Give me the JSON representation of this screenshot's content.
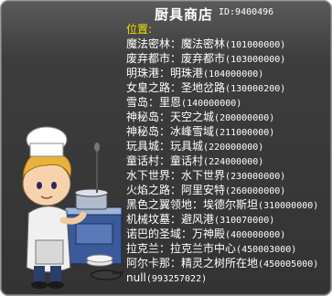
{
  "shop": {
    "title": "厨具商店",
    "npc_id": "ID:9400496",
    "header": "位置:",
    "locations": [
      {
        "region": "魔法密林",
        "sep": "：",
        "place": "魔法密林",
        "code": "(101000000)"
      },
      {
        "region": "废弃都市",
        "sep": "：",
        "place": "废弃都市",
        "code": "(103000000)"
      },
      {
        "region": "明珠港",
        "sep": "：",
        "place": "明珠港",
        "code": "(104000000)"
      },
      {
        "region": "女皇之路",
        "sep": "：",
        "place": "圣地岔路",
        "code": "(130000200)"
      },
      {
        "region": "雪岛",
        "sep": "：",
        "place": "里恩",
        "code": "(140000000)"
      },
      {
        "region": "神秘岛",
        "sep": "：",
        "place": "天空之城",
        "code": "(200000000)"
      },
      {
        "region": "神秘岛",
        "sep": "：",
        "place": "冰峰雪域",
        "code": "(211000000)"
      },
      {
        "region": "玩具城",
        "sep": "：",
        "place": "玩具城",
        "code": "(220000000)"
      },
      {
        "region": "童话村",
        "sep": "：",
        "place": "童话村",
        "code": "(224000000)"
      },
      {
        "region": "水下世界",
        "sep": "：",
        "place": "水下世界",
        "code": "(230000000)"
      },
      {
        "region": "火焰之路",
        "sep": "：",
        "place": "阿里安特",
        "code": "(260000000)"
      },
      {
        "region": "黑色之翼领地",
        "sep": "：",
        "place": "埃德尔斯坦",
        "code": "(310000000)"
      },
      {
        "region": "机械坟墓",
        "sep": "：",
        "place": "避风港",
        "code": "(310070000)"
      },
      {
        "region": "诺巴的圣域",
        "sep": "：",
        "place": "万神殿",
        "code": "(400000000)"
      },
      {
        "region": "拉克兰",
        "sep": "：",
        "place": "拉克兰市中心",
        "code": "(450003000)"
      },
      {
        "region": "阿尔卡那",
        "sep": "：",
        "place": "精灵之树所在地",
        "code": "(450005000)"
      },
      {
        "region": "null",
        "sep": "",
        "place": "",
        "code": "(993257022)"
      }
    ]
  }
}
